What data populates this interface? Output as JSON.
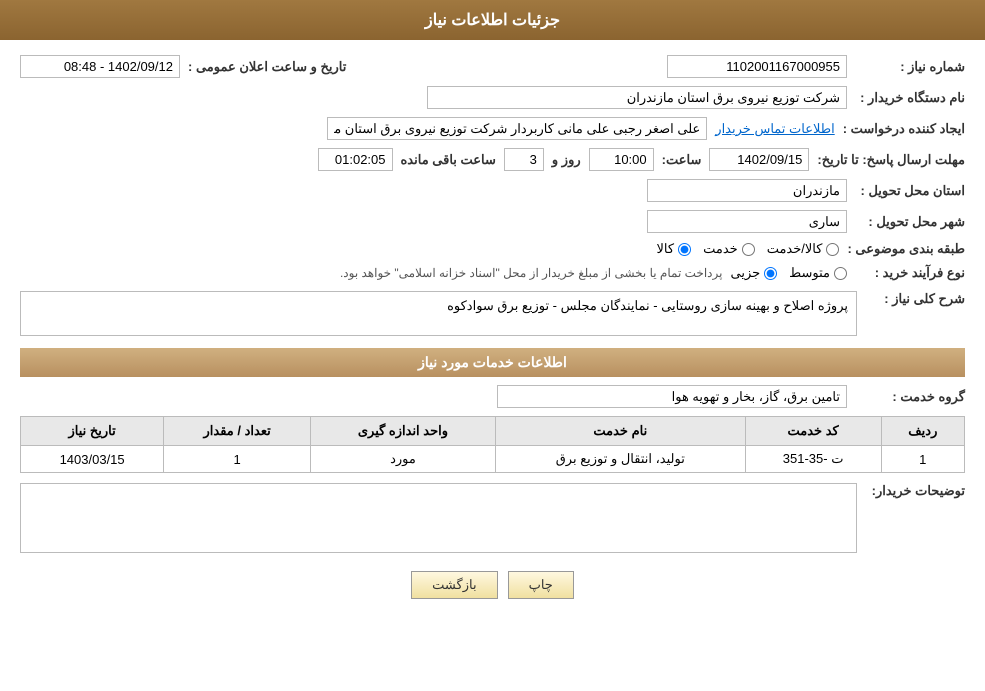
{
  "header": {
    "title": "جزئیات اطلاعات نیاز"
  },
  "fields": {
    "request_number_label": "شماره نیاز :",
    "request_number_value": "1102001167000955",
    "buyer_org_label": "نام دستگاه خریدار :",
    "buyer_org_value": "شرکت توزیع نیروی برق استان مازندران",
    "requester_label": "ایجاد کننده درخواست :",
    "requester_value": "علی اصغر رجبی علی مانی کاربردار شرکت توزیع نیروی برق استان مازندران",
    "requester_link": "اطلاعات تماس خریدار",
    "deadline_label": "مهلت ارسال پاسخ: تا تاریخ:",
    "deadline_date": "1402/09/15",
    "deadline_time_label": "ساعت:",
    "deadline_time": "10:00",
    "deadline_days_label": "روز و",
    "deadline_days": "3",
    "deadline_remaining_label": "ساعت باقی مانده",
    "deadline_remaining": "01:02:05",
    "delivery_province_label": "استان محل تحویل :",
    "delivery_province_value": "مازندران",
    "delivery_city_label": "شهر محل تحویل :",
    "delivery_city_value": "ساری",
    "category_label": "طبقه بندی موضوعی :",
    "category_options": [
      "کالا",
      "خدمت",
      "کالا/خدمت"
    ],
    "category_selected": "کالا",
    "purchase_type_label": "نوع فرآیند خرید :",
    "purchase_type_options": [
      "جزیی",
      "متوسط"
    ],
    "purchase_type_note": "پرداخت تمام یا بخشی از مبلغ خریدار از محل \"اسناد خزانه اسلامی\" خواهد بود.",
    "announcement_label": "تاریخ و ساعت اعلان عمومی :",
    "announcement_value": "1402/09/12 - 08:48"
  },
  "description_section": {
    "title": "شرح کلی نیاز :",
    "value": "پروژه اصلاح و بهینه سازی روستایی - نمایندگان مجلس - توزیع برق سوادکوه"
  },
  "services_section": {
    "title": "اطلاعات خدمات مورد نیاز",
    "service_group_label": "گروه خدمت :",
    "service_group_value": "تامین برق، گاز، بخار و تهویه هوا"
  },
  "table": {
    "columns": [
      "ردیف",
      "کد خدمت",
      "نام خدمت",
      "واحد اندازه گیری",
      "تعداد / مقدار",
      "تاریخ نیاز"
    ],
    "rows": [
      {
        "row_num": "1",
        "service_code": "ت -35-351",
        "service_name": "تولید، انتقال و توزیع برق",
        "unit": "مورد",
        "quantity": "1",
        "date": "1403/03/15"
      }
    ]
  },
  "buyer_notes_label": "توضیحات خریدار:",
  "buyer_notes_value": "",
  "buttons": {
    "back_label": "بازگشت",
    "print_label": "چاپ"
  }
}
